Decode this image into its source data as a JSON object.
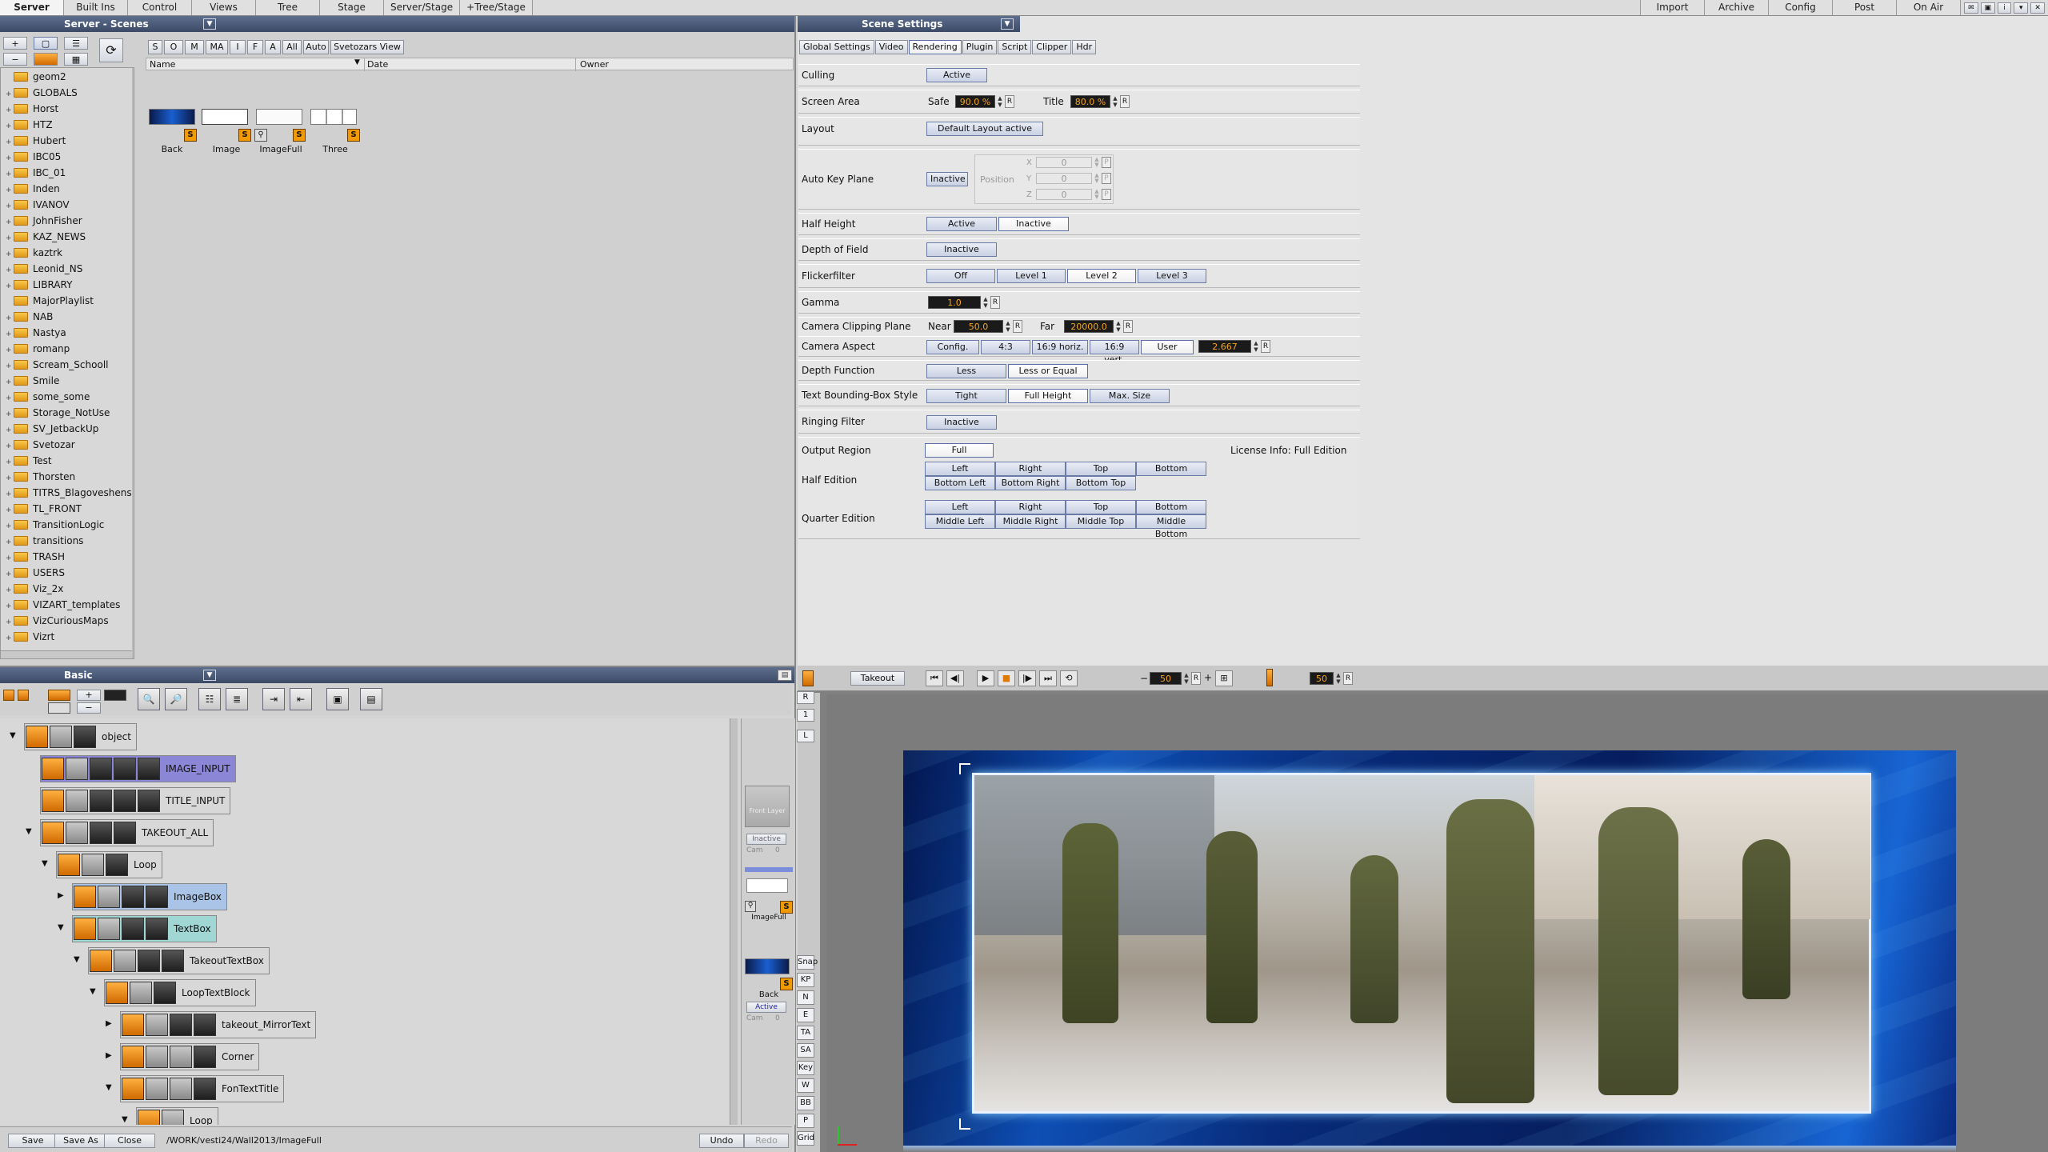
{
  "menu": {
    "tabs": [
      "Server",
      "Built Ins",
      "Control",
      "Views",
      "Tree",
      "Stage",
      "Server/Stage",
      "+Tree/Stage"
    ],
    "right_tabs": [
      "Import",
      "Archive",
      "Config",
      "Post",
      "On Air"
    ]
  },
  "server_panel": {
    "title": "Server - Scenes",
    "filter_buttons": [
      "S",
      "O",
      "M",
      "MA",
      "I",
      "F",
      "A",
      "All",
      "Auto",
      "Svetozars View"
    ],
    "columns": {
      "name": "Name",
      "date": "Date",
      "owner": "Owner"
    },
    "folders": [
      "geom2",
      "GLOBALS",
      "Horst",
      "HTZ",
      "Hubert",
      "IBC05",
      "IBC_01",
      "Inden",
      "IVANOV",
      "JohnFisher",
      "KAZ_NEWS",
      "kaztrk",
      "Leonid_NS",
      "LIBRARY",
      "MajorPlaylist",
      "NAB",
      "Nastya",
      "romanp",
      "Scream_Schooll",
      "Smile",
      "some_some",
      "Storage_NotUse",
      "SV_JetbackUp",
      "Svetozar",
      "Test",
      "Thorsten",
      "TITRS_Blagoveshensk",
      "TL_FRONT",
      "TransitionLogic",
      "transitions",
      "TRASH",
      "USERS",
      "Viz_2x",
      "VIZART_templates",
      "VizCuriousMaps",
      "Vizrt"
    ],
    "scenes": [
      "Back",
      "Image",
      "ImageFull",
      "Three"
    ]
  },
  "scene_settings": {
    "title": "Scene Settings",
    "tabs": [
      "Global Settings",
      "Video",
      "Rendering",
      "Plugin",
      "Script",
      "Clipper",
      "Hdr"
    ],
    "active_tab": "Rendering",
    "culling": {
      "label": "Culling",
      "value": "Active"
    },
    "screen_area": {
      "label": "Screen Area",
      "safe_label": "Safe",
      "safe": "90.0 %",
      "title_label": "Title",
      "title": "80.0 %",
      "r": "R"
    },
    "layout": {
      "label": "Layout",
      "value": "Default Layout active"
    },
    "auto_key": {
      "label": "Auto Key Plane",
      "state": "Inactive",
      "position_label": "Position",
      "x_label": "X",
      "y_label": "Y",
      "z_label": "Z",
      "x": "0",
      "y": "0",
      "z": "0",
      "p": "P"
    },
    "half_height": {
      "label": "Half Height",
      "options": [
        "Active",
        "Inactive"
      ]
    },
    "depth_of_field": {
      "label": "Depth of Field",
      "value": "Inactive"
    },
    "flickerfilter": {
      "label": "Flickerfilter",
      "options": [
        "Off",
        "Level 1",
        "Level 2",
        "Level 3"
      ]
    },
    "gamma": {
      "label": "Gamma",
      "value": "1.0"
    },
    "clipping": {
      "label": "Camera Clipping Plane",
      "near_label": "Near",
      "near": "50.0",
      "far_label": "Far",
      "far": "20000.0"
    },
    "aspect": {
      "label": "Camera Aspect",
      "options": [
        "Config.",
        "4:3",
        "16:9 horiz.",
        "16:9 vert.",
        "User"
      ],
      "value": "2.667"
    },
    "depth_function": {
      "label": "Depth Function",
      "options": [
        "Less",
        "Less or Equal"
      ]
    },
    "text_bbox": {
      "label": "Text Bounding-Box Style",
      "options": [
        "Tight",
        "Full Height",
        "Max. Size"
      ]
    },
    "ringing": {
      "label": "Ringing Filter",
      "value": "Inactive"
    },
    "output_region": {
      "label": "Output Region",
      "value": "Full",
      "license": "License Info: Full Edition"
    },
    "half_edition": {
      "label": "Half Edition",
      "row1": [
        "Left",
        "Right",
        "Top",
        "Bottom"
      ],
      "row2": [
        "Bottom Left",
        "Bottom Right",
        "Bottom Top"
      ]
    },
    "quarter_edition": {
      "label": "Quarter Edition",
      "row1": [
        "Left",
        "Right",
        "Top",
        "Bottom"
      ],
      "row2": [
        "Middle Left",
        "Middle Right",
        "Middle Top",
        "Middle Bottom"
      ]
    }
  },
  "tree_panel": {
    "title": "Basic",
    "nodes": [
      "object",
      "IMAGE_INPUT",
      "TITLE_INPUT",
      "TAKEOUT_ALL",
      "Loop",
      "ImageBox",
      "TextBox",
      "TakeoutTextBox",
      "LoopTextBlock",
      "takeout_MirrorText",
      "Corner",
      "FonTextTitle",
      "Loop"
    ],
    "side_items": {
      "front_layer": "Front Layer",
      "inactive": "Inactive",
      "cam": "Cam",
      "imagefull": "ImageFull",
      "back": "Back",
      "active": "Active",
      "cam2": "Cam",
      "zero": "0"
    },
    "footer": {
      "save": "Save",
      "save_as": "Save As",
      "close": "Close",
      "path": "/WORK/vesti24/Wall2013/ImageFull",
      "undo": "Undo",
      "redo": "Redo"
    }
  },
  "stage_bar": {
    "director": "Takeout",
    "frame": "50",
    "frame2": "50",
    "side_buttons": [
      "R",
      "1",
      "L",
      "Snap",
      "KP",
      "N",
      "E",
      "TA",
      "SA",
      "Key",
      "W",
      "BB",
      "P",
      "Grid"
    ]
  }
}
